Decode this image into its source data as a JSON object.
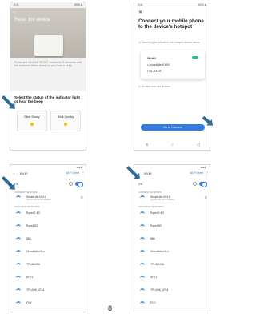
{
  "screen1": {
    "status": {
      "left": "9:41",
      "right": "80% ▮"
    },
    "back": "‹",
    "title": "Reset the device",
    "description": "Press and hold the RESET button for 5 seconds until the indicator blinks slowly or you hear a beep.",
    "question": "Select the status of the indicator light or hear the beep",
    "option_slow": "Blink Slowly",
    "option_quick": "Blink Quickly"
  },
  "screen2": {
    "status": {
      "left": "9:41",
      "right": "80% ▮"
    },
    "close": "✕",
    "heading": "Connect your mobile phone to the device's hotspot",
    "subtitle": "① Connect your phone to the hotspot shown below",
    "card_title": "WLAN",
    "card_row1": "• SmartLife-XXXX",
    "card_row2": "• SL-XXXX",
    "help": "② Go back and add devices",
    "button": "Go to Connect",
    "nav": [
      "≡",
      "○",
      "◁"
    ]
  },
  "wifi_list": {
    "back": "‹",
    "title": "Wi-Fi",
    "direct": "Wi-Fi Direct",
    "more": "⋮",
    "on_label": "On",
    "current_section": "CURRENT NETWORK",
    "current": {
      "name": "SmartLife-XXX1",
      "sub": "Internet may not be available"
    },
    "available_section": "AVAILABLE NETWORKS",
    "networks": [
      "Ryse02 4G",
      "Ryse03G",
      "888",
      "ChinaNet-xYLx",
      "TPUNK006",
      "SFT1",
      "TP-LINK_4761",
      "FCY"
    ]
  },
  "page_number": "8",
  "colors": {
    "accent": "#2f7de1",
    "arrow": "#2f6b95"
  }
}
